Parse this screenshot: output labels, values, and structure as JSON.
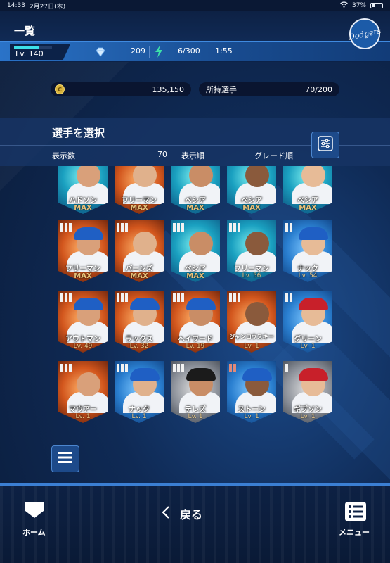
{
  "status_bar": {
    "time": "14:33",
    "date": "2月27日(木)",
    "battery": "37%"
  },
  "header": {
    "title": "一覧",
    "team_logo_text": "Dodgers"
  },
  "resources": {
    "level_label": "Lv. 140",
    "level_progress": 0.65,
    "gems": "209",
    "stamina": "6/300",
    "timer": "1:55"
  },
  "coins": {
    "value": "135,150",
    "icon_letter": "C"
  },
  "roster": {
    "label": "所持選手",
    "count": "70/200"
  },
  "select_panel": {
    "heading": "選手を選択",
    "display_count_label": "表示数",
    "display_count_value": "70",
    "sort_label": "表示順",
    "sort_value": "グレード順"
  },
  "cards": [
    {
      "name": "ハドソン",
      "level": "MAX",
      "grade_count": 0,
      "bg": "teal",
      "cap": "none"
    },
    {
      "name": "フリーマン",
      "level": "MAX",
      "grade_count": 0,
      "bg": "orange",
      "cap": "none"
    },
    {
      "name": "ベシア",
      "level": "MAX",
      "grade_count": 0,
      "bg": "teal",
      "cap": "none"
    },
    {
      "name": "ベシア",
      "level": "MAX",
      "grade_count": 0,
      "bg": "teal",
      "cap": "none"
    },
    {
      "name": "ベシア",
      "level": "MAX",
      "grade_count": 0,
      "bg": "teal",
      "cap": "none"
    },
    {
      "name": "フリーマン",
      "level": "MAX",
      "grade_count": 3,
      "bg": "orange",
      "cap": "blue"
    },
    {
      "name": "バーンズ",
      "level": "MAX",
      "grade_count": 3,
      "bg": "orange",
      "cap": "none"
    },
    {
      "name": "ベシア",
      "level": "MAX",
      "grade_count": 3,
      "bg": "teal",
      "cap": "none"
    },
    {
      "name": "フリーマン",
      "level": "Lv. 56",
      "grade_count": 3,
      "bg": "teal",
      "cap": "none"
    },
    {
      "name": "ナック",
      "level": "Lv. 54",
      "grade_count": 2,
      "bg": "blue",
      "cap": "blue"
    },
    {
      "name": "アウトマン",
      "level": "Lv. 49",
      "grade_count": 3,
      "bg": "orange",
      "cap": "blue"
    },
    {
      "name": "ラックス",
      "level": "Lv. 32",
      "grade_count": 3,
      "bg": "orange",
      "cap": "blue"
    },
    {
      "name": "ヘイワード",
      "level": "Lv. 19",
      "grade_count": 3,
      "bg": "orange",
      "cap": "blue"
    },
    {
      "name": "ジャンコウスキー",
      "level": "Lv. 1",
      "grade_count": 3,
      "bg": "orange",
      "cap": "none"
    },
    {
      "name": "グリーン",
      "level": "Lv. 1",
      "grade_count": 2,
      "bg": "blue",
      "cap": "red"
    },
    {
      "name": "マウアー",
      "level": "Lv. 1",
      "grade_count": 3,
      "bg": "orange",
      "cap": "none"
    },
    {
      "name": "ナック",
      "level": "Lv. 1",
      "grade_count": 3,
      "bg": "blue",
      "cap": "blue"
    },
    {
      "name": "テレズ",
      "level": "Lv. 1",
      "grade_count": 3,
      "bg": "gray",
      "cap": "black"
    },
    {
      "name": "ストーン",
      "level": "Lv. 1",
      "grade_count": 2,
      "bg": "blue",
      "cap": "blue",
      "grade_color": "#e08a7a"
    },
    {
      "name": "ギブソン",
      "level": "Lv. 1",
      "grade_count": 1,
      "bg": "gray",
      "cap": "red"
    }
  ],
  "footer": {
    "home_label": "ホーム",
    "back_label": "戻る",
    "menu_label": "メニュー"
  },
  "colors": {
    "accent": "#3de0e8",
    "brand_blue": "#1c5ba8",
    "gold": "#e9c27a"
  }
}
